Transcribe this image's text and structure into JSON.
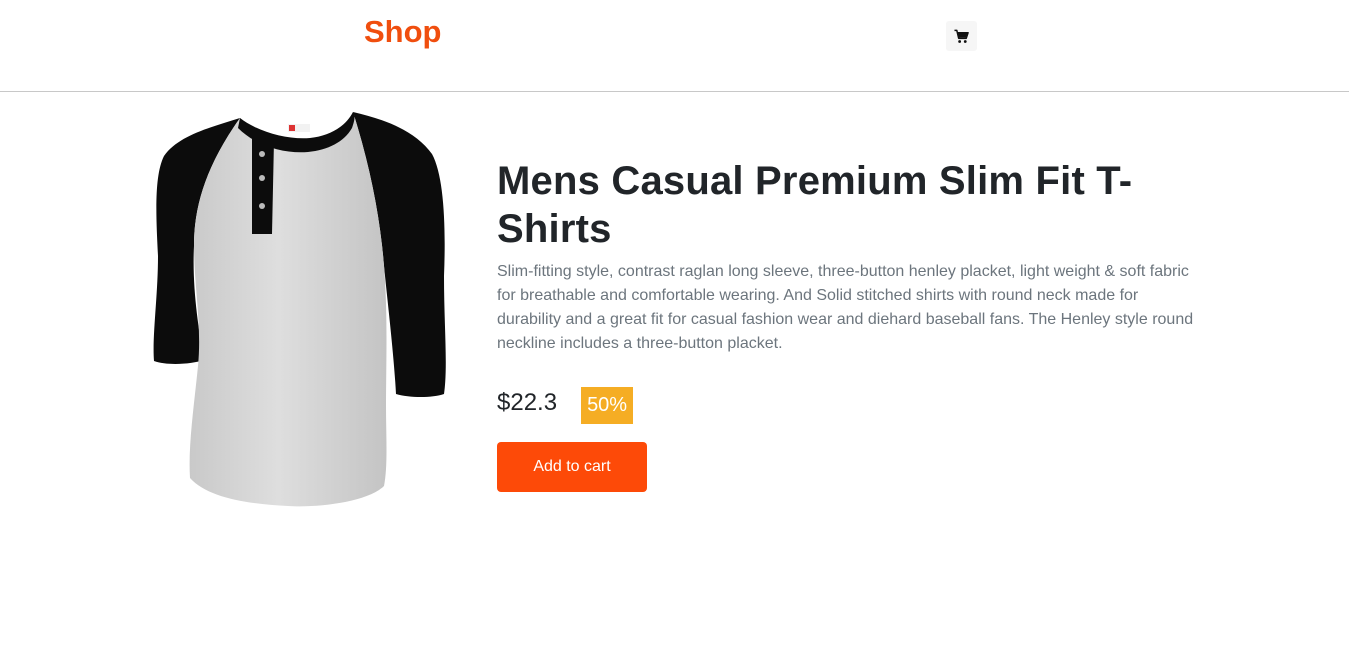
{
  "header": {
    "brand": "Shop",
    "cart_icon": "shopping-cart-icon"
  },
  "product": {
    "image_icon": "product-shirt-image",
    "title": "Mens Casual Premium Slim Fit T-Shirts",
    "description": "Slim-fitting style, contrast raglan long sleeve, three-button henley placket, light weight & soft fabric for breathable and comfortable wearing. And Solid stitched shirts with round neck made for durability and a great fit for casual fashion wear and diehard baseball fans. The Henley style round neckline includes a three-button placket.",
    "price": "$22.3",
    "discount": "50%",
    "add_to_cart_label": "Add to cart"
  },
  "colors": {
    "brand": "#f04e0e",
    "button": "#fd4a08",
    "discount_badge": "#f5ad24",
    "description_text": "#6c757d"
  }
}
